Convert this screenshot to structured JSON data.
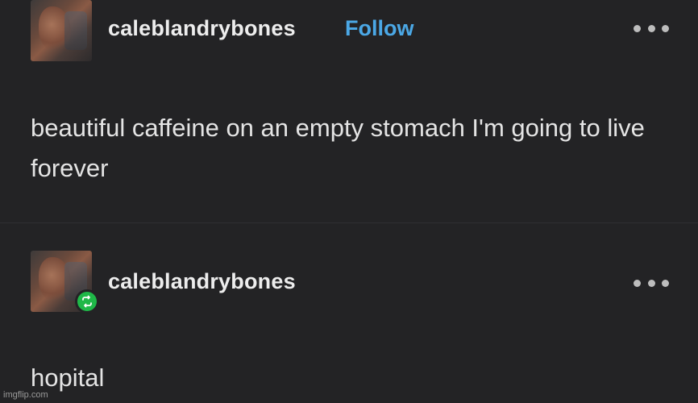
{
  "post1": {
    "username": "caleblandrybones",
    "follow_label": "Follow",
    "body": "beautiful caffeine on an empty stomach I'm going to live forever"
  },
  "post2": {
    "username": "caleblandrybones",
    "body": "hopital",
    "reblog_icon": "reblog-icon"
  },
  "more_icon": "more-options-icon",
  "watermark": "imgflip.com",
  "colors": {
    "background": "#232325",
    "follow": "#4ba8e6",
    "reblog_badge": "#1fb848"
  }
}
